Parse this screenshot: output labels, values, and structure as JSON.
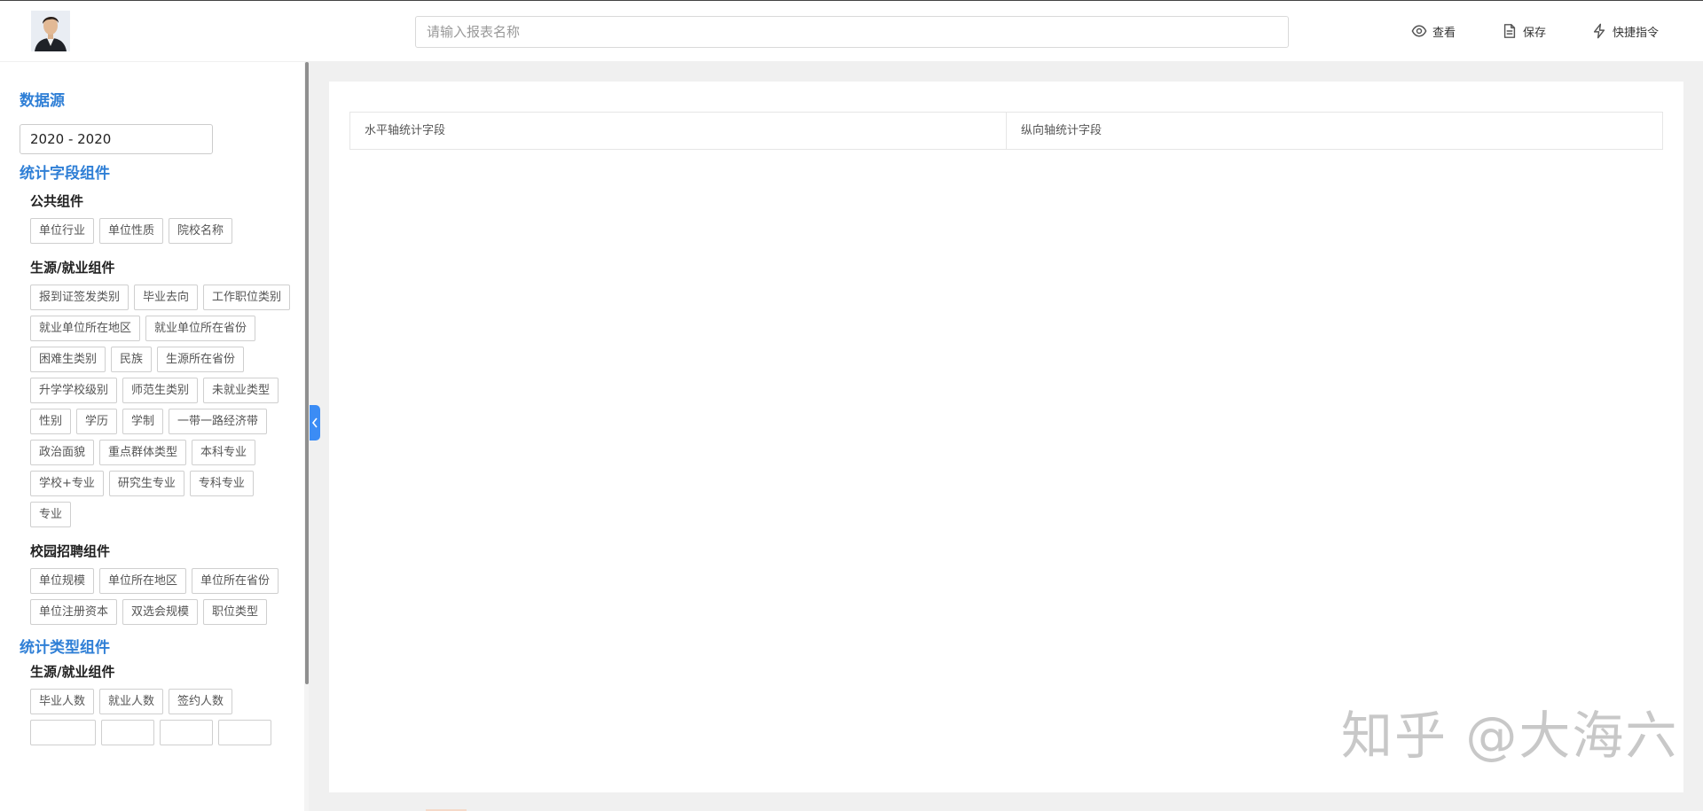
{
  "header": {
    "search_placeholder": "请输入报表名称",
    "view_label": "查看",
    "save_label": "保存",
    "shortcut_label": "快捷指令"
  },
  "sidebar": {
    "datasource_title": "数据源",
    "datasource_value": "2020 - 2020",
    "stat_field_title": "统计字段组件",
    "groups": [
      {
        "title": "公共组件",
        "tags": [
          "单位行业",
          "单位性质",
          "院校名称"
        ]
      },
      {
        "title": "生源/就业组件",
        "tags": [
          "报到证签发类别",
          "毕业去向",
          "工作职位类别",
          "就业单位所在地区",
          "就业单位所在省份",
          "困难生类别",
          "民族",
          "生源所在省份",
          "升学学校级别",
          "师范生类别",
          "未就业类型",
          "性别",
          "学历",
          "学制",
          "一带一路经济带",
          "政治面貌",
          "重点群体类型",
          "本科专业",
          "学校+专业",
          "研究生专业",
          "专科专业",
          "专业"
        ]
      },
      {
        "title": "校园招聘组件",
        "tags": [
          "单位规模",
          "单位所在地区",
          "单位所在省份",
          "单位注册资本",
          "双选会规模",
          "职位类型"
        ]
      }
    ],
    "stat_type_title": "统计类型组件",
    "type_groups": [
      {
        "title": "生源/就业组件",
        "tags": [
          "毕业人数",
          "就业人数",
          "签约人数",
          "",
          "",
          "",
          ""
        ]
      }
    ]
  },
  "main": {
    "horizontal_axis_label": "水平轴统计字段",
    "vertical_axis_label": "纵向轴统计字段"
  },
  "watermark": "知乎 @大海六"
}
